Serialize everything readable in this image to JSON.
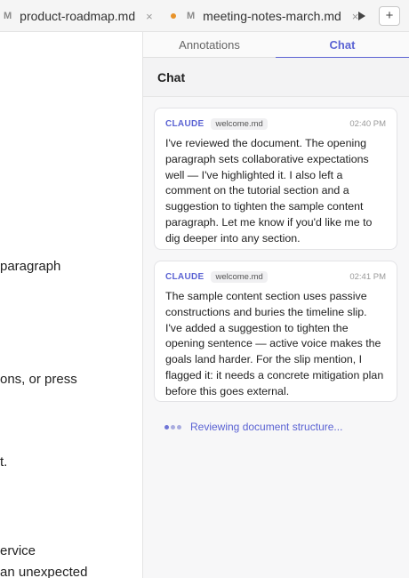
{
  "tabs": [
    {
      "icon": "M",
      "label": "product-roadmap.md",
      "close": "×",
      "modified": false
    },
    {
      "icon": "M",
      "label": "meeting-notes-march.md",
      "close": "×",
      "modified": true
    }
  ],
  "toolbar": {
    "add_label": "+"
  },
  "editor": {
    "lines": [
      "paragraph",
      "ons, or press",
      "t.",
      "ervice",
      "an unexpected"
    ]
  },
  "panel": {
    "tabs": [
      "Annotations",
      "Chat"
    ],
    "active_tab": "Chat",
    "header": "Chat",
    "messages": [
      {
        "sender": "CLAUDE",
        "file": "welcome.md",
        "time": "02:40 PM",
        "text": "I've reviewed the document. The opening paragraph sets collaborative expectations well — I've highlighted it. I also left a comment on the tutorial section and a suggestion to tighten the sample content paragraph. Let me know if you'd like me to dig deeper into any section."
      },
      {
        "sender": "CLAUDE",
        "file": "welcome.md",
        "time": "02:41 PM",
        "text": "The sample content section uses passive constructions and buries the timeline slip. I've added a suggestion to tighten the opening sentence — active voice makes the goals land harder. For the slip mention, I flagged it: it needs a concrete mitigation plan before this goes external."
      }
    ],
    "status": "Reviewing document structure..."
  },
  "colors": {
    "accent": "#5b63d3",
    "modified_dot": "#e8932a"
  }
}
